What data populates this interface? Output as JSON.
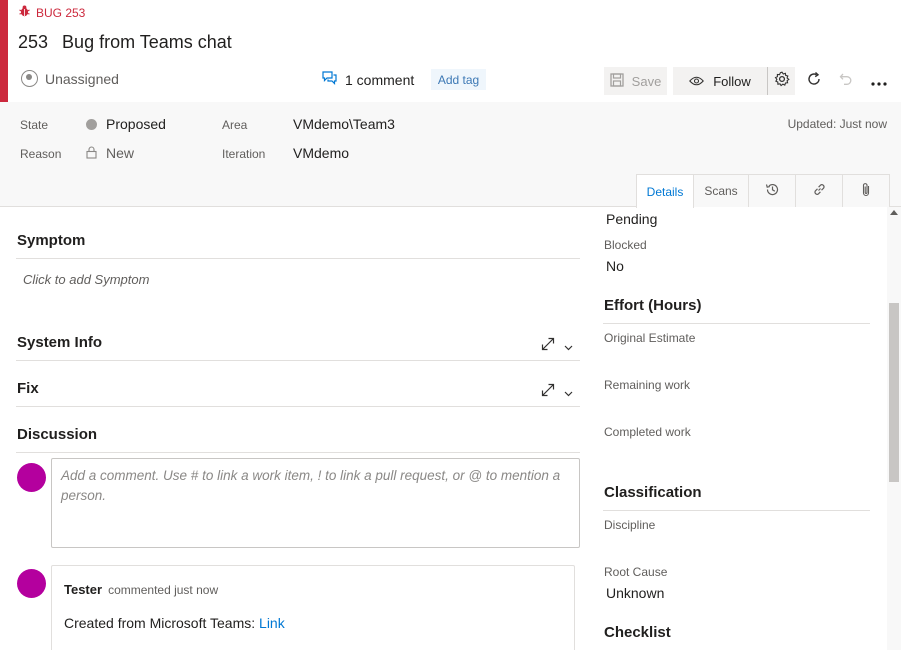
{
  "header": {
    "type_label": "BUG 253",
    "id": "253",
    "title": "Bug from Teams chat",
    "assigned": "Unassigned",
    "comment_count": "1 comment",
    "add_tag": "Add tag",
    "accent_color": "#cc293d"
  },
  "toolbar": {
    "save_label": "Save",
    "follow_label": "Follow"
  },
  "fields": {
    "state_label": "State",
    "state_value": "Proposed",
    "reason_label": "Reason",
    "reason_value": "New",
    "area_label": "Area",
    "area_value": "VMdemo\\Team3",
    "iteration_label": "Iteration",
    "iteration_value": "VMdemo",
    "updated": "Updated: Just now"
  },
  "tabs": [
    {
      "label": "Details",
      "active": true
    },
    {
      "label": "Scans",
      "active": false
    },
    {
      "icon": "history-icon"
    },
    {
      "icon": "link-icon"
    },
    {
      "icon": "attachment-icon"
    }
  ],
  "left": {
    "symptom_title": "Symptom",
    "symptom_placeholder": "Click to add Symptom",
    "sysinfo_title": "System Info",
    "fix_title": "Fix",
    "discussion_title": "Discussion",
    "comment_placeholder": "Add a comment. Use # to link a work item, ! to link a pull request, or @ to mention a person.",
    "comment": {
      "author": "Tester",
      "meta": "commented just now",
      "body": "Created from Microsoft Teams: ",
      "link": "Link"
    }
  },
  "right": {
    "pending_value": "Pending",
    "blocked_label": "Blocked",
    "blocked_value": "No",
    "effort_title": "Effort (Hours)",
    "original_estimate": "Original Estimate",
    "remaining_work": "Remaining work",
    "completed_work": "Completed work",
    "classification_title": "Classification",
    "discipline_label": "Discipline",
    "root_cause_label": "Root Cause",
    "root_cause_value": "Unknown",
    "checklist_title": "Checklist"
  }
}
